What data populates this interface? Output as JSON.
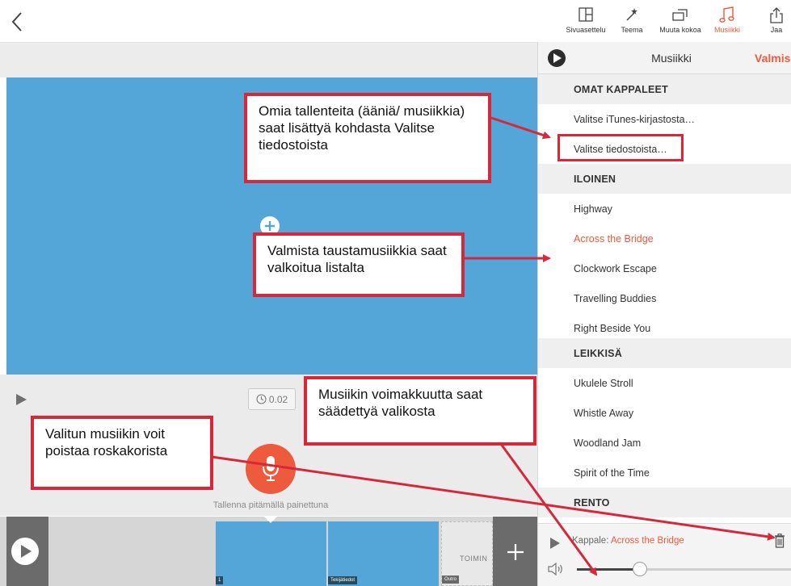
{
  "toolbar": {
    "items": [
      {
        "label": "Sivuasettelu",
        "icon": "layout-icon"
      },
      {
        "label": "Teema",
        "icon": "theme-wand-icon"
      },
      {
        "label": "Muuta kokoa",
        "icon": "resize-icon"
      },
      {
        "label": "Musiikki",
        "icon": "music-note-icon"
      },
      {
        "label": "Jaa",
        "icon": "share-icon"
      }
    ],
    "active": "Musiikki"
  },
  "editor": {
    "duration": "0.02",
    "record_hint": "Tallenna pitämällä painettuna"
  },
  "timeline": {
    "clips": [
      {
        "tag": "1"
      },
      {
        "tag": "Tekijätiedot"
      },
      {
        "tag": "Outro"
      }
    ],
    "outro_text": "TOIMIN"
  },
  "music_panel": {
    "title": "Musiikki",
    "done": "Valmis",
    "rows": [
      {
        "text": "OMAT KAPPALEET",
        "kind": "section"
      },
      {
        "text": "Valitse iTunes-kirjastosta…",
        "kind": "item"
      },
      {
        "text": "Valitse tiedostoista…",
        "kind": "item"
      },
      {
        "text": "ILOINEN",
        "kind": "section"
      },
      {
        "text": "Highway",
        "kind": "item"
      },
      {
        "text": "Across the Bridge",
        "kind": "selected"
      },
      {
        "text": "Clockwork Escape",
        "kind": "item"
      },
      {
        "text": "Travelling Buddies",
        "kind": "item"
      },
      {
        "text": "Right Beside You",
        "kind": "item"
      },
      {
        "text": "LEIKKISÄ",
        "kind": "section"
      },
      {
        "text": "Ukulele Stroll",
        "kind": "item"
      },
      {
        "text": "Whistle Away",
        "kind": "item"
      },
      {
        "text": "Woodland Jam",
        "kind": "item"
      },
      {
        "text": "Spirit of the Time",
        "kind": "item"
      },
      {
        "text": "RENTO",
        "kind": "section"
      }
    ],
    "footer": {
      "song_label": "Kappale:",
      "song_value": "Across the Bridge",
      "volume_fraction": 0.29
    }
  },
  "annotations": {
    "own_recordings": "Omia tallenteita (ääniä/ musiikkia) saat lisättyä kohdasta Valitse tiedostoista",
    "background_music": "Valmista taustamusiikkia saat valkoitua listalta",
    "volume": "Musiikin voimakkuutta saat säädettyä valikosta",
    "trash": "Valitun musiikin voit poistaa roskakorista"
  },
  "colors": {
    "accent": "#ee5a3c",
    "stage": "#55a6d8",
    "annotation": "#d7283b"
  }
}
